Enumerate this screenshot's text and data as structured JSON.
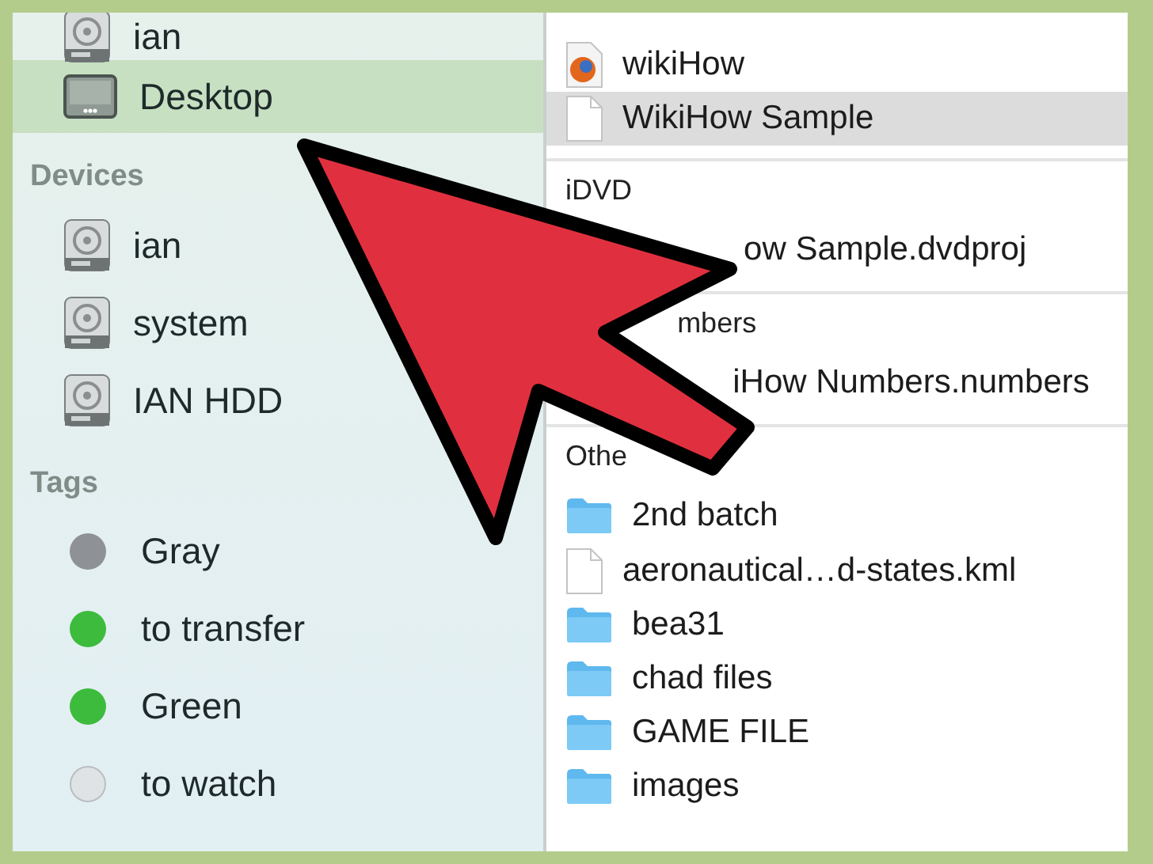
{
  "sidebar": {
    "sections": [
      {
        "items": [
          {
            "label": "ian",
            "kind": "drive",
            "selected": false
          },
          {
            "label": "Desktop",
            "kind": "desktop",
            "selected": true
          }
        ]
      },
      {
        "header": "Devices",
        "items": [
          {
            "label": "ian",
            "kind": "drive",
            "selected": false
          },
          {
            "label": "system",
            "kind": "drive",
            "selected": false
          },
          {
            "label": "IAN HDD",
            "kind": "drive",
            "selected": false
          }
        ]
      },
      {
        "header": "Tags",
        "items": [
          {
            "label": "Gray",
            "kind": "tag",
            "color": "#8e9196",
            "selected": false
          },
          {
            "label": "to transfer",
            "kind": "tag",
            "color": "#3dbb3d",
            "selected": false
          },
          {
            "label": "Green",
            "kind": "tag",
            "color": "#3dbb3d",
            "selected": false
          },
          {
            "label": "to watch",
            "kind": "tag",
            "color": "#dfe3e6",
            "selected": false
          }
        ]
      }
    ]
  },
  "files": {
    "groups": [
      {
        "items": [
          {
            "name": "wikiHow",
            "kind": "web-page",
            "selected": false
          },
          {
            "name": "WikiHow Sample",
            "kind": "document",
            "selected": true
          }
        ]
      },
      {
        "header": "iDVD",
        "items": [
          {
            "name": "ow Sample.dvdproj",
            "kind": "hidden",
            "selected": false
          }
        ]
      },
      {
        "header": "mbers",
        "items": [
          {
            "name": "iHow Numbers.numbers",
            "kind": "hidden",
            "selected": false
          }
        ]
      },
      {
        "header": "Othe",
        "items": [
          {
            "name": "2nd batch",
            "kind": "folder",
            "selected": false
          },
          {
            "name": "aeronautical…d-states.kml",
            "kind": "document",
            "selected": false
          },
          {
            "name": "bea31",
            "kind": "folder",
            "selected": false
          },
          {
            "name": "chad files",
            "kind": "folder",
            "selected": false
          },
          {
            "name": "GAME FILE",
            "kind": "folder",
            "selected": false
          },
          {
            "name": "images",
            "kind": "folder",
            "selected": false
          }
        ]
      }
    ]
  }
}
